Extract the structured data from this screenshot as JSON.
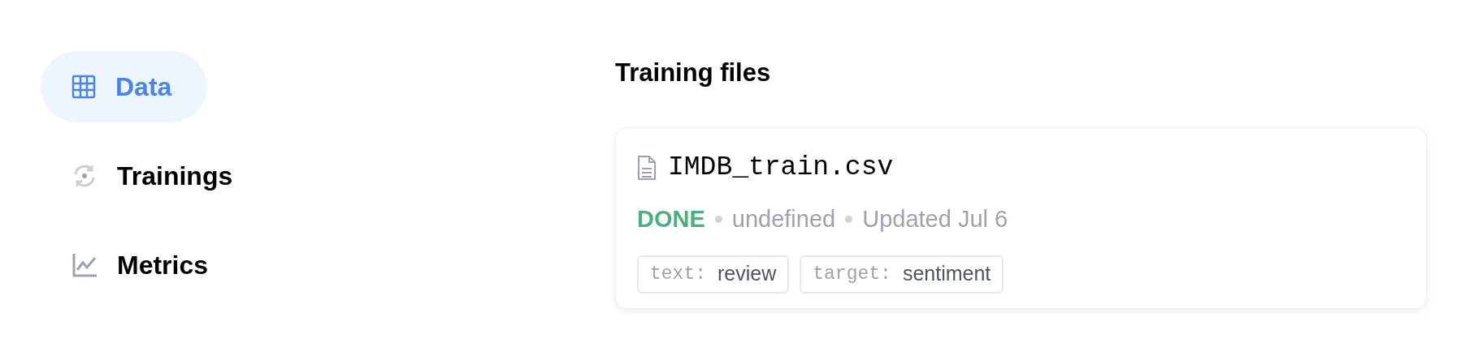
{
  "sidebar": {
    "items": [
      {
        "label": "Data",
        "kind": "grid",
        "selected": true
      },
      {
        "label": "Trainings",
        "kind": "sync",
        "selected": false
      },
      {
        "label": "Metrics",
        "kind": "chart",
        "selected": false
      }
    ]
  },
  "section_title": "Training files",
  "files": [
    {
      "name": "IMDB_train.csv",
      "status": "DONE",
      "color": "#4caf7f",
      "size": "undefined",
      "updated": "Updated Jul 6",
      "tags": [
        {
          "key": "text:",
          "value": "review"
        },
        {
          "key": "target:",
          "value": "sentiment"
        }
      ]
    }
  ]
}
